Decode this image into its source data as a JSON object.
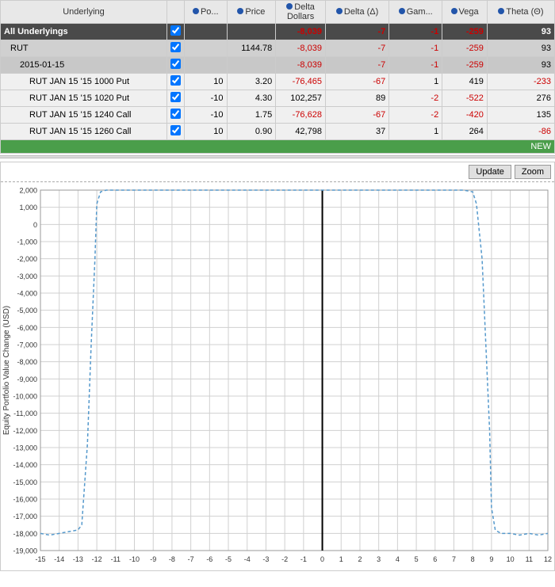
{
  "table": {
    "headers": [
      "Underlying",
      "",
      "Po...",
      "Price",
      "Delta Dollars",
      "Delta (Δ)",
      "Gam...",
      "Vega",
      "Theta (Θ)"
    ],
    "rows": [
      {
        "type": "all-underlyings",
        "label": "All Underlyings",
        "checked": true,
        "pos": "",
        "price": "",
        "delta_dollars": "-8,039",
        "delta": "-7",
        "gamma": "-1",
        "vega": "-259",
        "theta": "93"
      },
      {
        "type": "rut",
        "label": "RUT",
        "checked": true,
        "pos": "",
        "price": "1144.78",
        "delta_dollars": "-8,039",
        "delta": "-7",
        "gamma": "-1",
        "vega": "-259",
        "theta": "93"
      },
      {
        "type": "date",
        "label": "2015-01-15",
        "checked": true,
        "pos": "",
        "price": "",
        "delta_dollars": "-8,039",
        "delta": "-7",
        "gamma": "-1",
        "vega": "-259",
        "theta": "93"
      },
      {
        "type": "option",
        "label": "RUT JAN 15 '15 1000 Put",
        "checked": true,
        "pos": "10",
        "price": "3.20",
        "delta_dollars": "-76,465",
        "delta": "-67",
        "gamma": "1",
        "vega": "419",
        "theta": "-233"
      },
      {
        "type": "option",
        "label": "RUT JAN 15 '15 1020 Put",
        "checked": true,
        "pos": "-10",
        "price": "4.30",
        "delta_dollars": "102,257",
        "delta": "89",
        "gamma": "-2",
        "vega": "-522",
        "theta": "276"
      },
      {
        "type": "option",
        "label": "RUT JAN 15 '15 1240 Call",
        "checked": true,
        "pos": "-10",
        "price": "1.75",
        "delta_dollars": "-76,628",
        "delta": "-67",
        "gamma": "-2",
        "vega": "-420",
        "theta": "135"
      },
      {
        "type": "option",
        "label": "RUT JAN 15 '15 1260 Call",
        "checked": true,
        "pos": "10",
        "price": "0.90",
        "delta_dollars": "42,798",
        "delta": "37",
        "gamma": "1",
        "vega": "264",
        "theta": "-86"
      },
      {
        "type": "new",
        "label": "NEW"
      }
    ]
  },
  "chart": {
    "update_label": "Update",
    "zoom_label": "Zoom",
    "y_axis_label": "Equity Portfolio Value Change (USD)",
    "x_min": -15,
    "x_max": 12,
    "y_min": -19000,
    "y_max": 2000,
    "y_ticks": [
      2000,
      1000,
      0,
      -1000,
      -2000,
      -3000,
      -4000,
      -5000,
      -6000,
      -7000,
      -8000,
      -9000,
      -10000,
      -11000,
      -12000,
      -13000,
      -14000,
      -15000,
      -16000,
      -17000,
      -18000,
      -19000
    ],
    "x_ticks": [
      -15,
      -14,
      -13,
      -12,
      -11,
      -10,
      -9,
      -8,
      -7,
      -6,
      -5,
      -4,
      -3,
      -2,
      -1,
      0,
      1,
      2,
      3,
      4,
      5,
      6,
      7,
      8,
      9,
      10,
      11,
      12
    ]
  }
}
